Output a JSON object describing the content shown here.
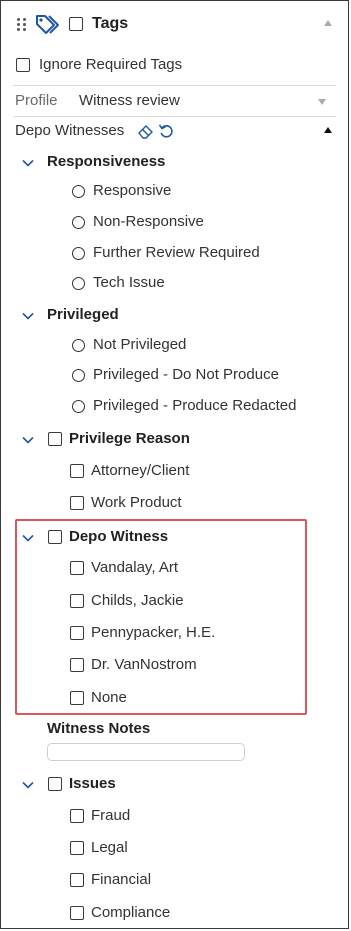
{
  "header": {
    "title": "Tags"
  },
  "ignore_required": {
    "label": "Ignore Required Tags"
  },
  "profile": {
    "label": "Profile",
    "value": "Witness review"
  },
  "section": {
    "title": "Depo Witnesses"
  },
  "groups": {
    "responsiveness": {
      "title": "Responsiveness",
      "options": [
        "Responsive",
        "Non-Responsive",
        "Further Review Required",
        "Tech Issue"
      ]
    },
    "privileged": {
      "title": "Privileged",
      "options": [
        "Not Privileged",
        "Privileged - Do Not Produce",
        "Privileged - Produce Redacted"
      ]
    },
    "privilege_reason": {
      "title": "Privilege Reason",
      "options": [
        "Attorney/Client",
        "Work Product"
      ]
    },
    "depo_witness": {
      "title": "Depo Witness",
      "options": [
        "Vandalay, Art",
        "Childs, Jackie",
        "Pennypacker, H.E.",
        "Dr. VanNostrom",
        "None"
      ]
    },
    "witness_notes": {
      "title": "Witness Notes",
      "value": ""
    },
    "issues": {
      "title": "Issues",
      "options": [
        "Fraud",
        "Legal",
        "Financial",
        "Compliance"
      ]
    }
  },
  "colors": {
    "accent": "#1f56a8",
    "highlight": "#e0555b"
  },
  "icons": [
    "drag-handle-icon",
    "tag-icon",
    "eraser-icon",
    "refresh-icon",
    "chevron-down-icon"
  ]
}
